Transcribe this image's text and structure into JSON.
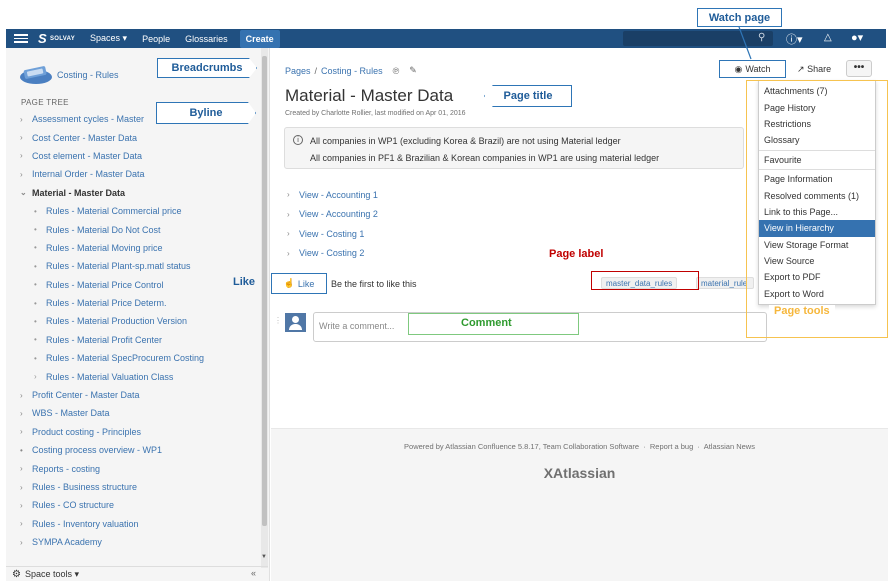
{
  "nav": {
    "logo": "SOLVAY",
    "items": [
      "Spaces ▾",
      "People",
      "Glossaries"
    ],
    "create": "Create"
  },
  "sidebar": {
    "space_title": "Costing - Rules",
    "tree_heading": "PAGE TREE",
    "tree": [
      {
        "label": "Assessment cycles - Master",
        "chev": "›"
      },
      {
        "label": "Cost Center - Master Data",
        "chev": "›"
      },
      {
        "label": "Cost element - Master Data",
        "chev": "›"
      },
      {
        "label": "Internal Order - Master Data",
        "chev": "›"
      },
      {
        "label": "Material - Master Data",
        "chev": "⌄"
      },
      {
        "label": "Rules - Material Commercial price",
        "chev": "•"
      },
      {
        "label": "Rules - Material Do Not Cost",
        "chev": "•"
      },
      {
        "label": "Rules - Material Moving price",
        "chev": "•"
      },
      {
        "label": "Rules - Material Plant-sp.matl status",
        "chev": "•"
      },
      {
        "label": "Rules - Material Price Control",
        "chev": "•"
      },
      {
        "label": "Rules - Material Price Determ.",
        "chev": "•"
      },
      {
        "label": "Rules - Material Production Version",
        "chev": "•"
      },
      {
        "label": "Rules - Material Profit Center",
        "chev": "•"
      },
      {
        "label": "Rules - Material SpecProcurem Costing",
        "chev": "•"
      },
      {
        "label": "Rules - Material Valuation Class",
        "chev": "›"
      },
      {
        "label": "Profit Center - Master Data",
        "chev": "›"
      },
      {
        "label": "WBS - Master Data",
        "chev": "›"
      },
      {
        "label": "Product costing - Principles",
        "chev": "›"
      },
      {
        "label": "Costing process overview - WP1",
        "chev": "•"
      },
      {
        "label": "Reports - costing",
        "chev": "›"
      },
      {
        "label": "Rules - Business structure",
        "chev": "›"
      },
      {
        "label": "Rules - CO structure",
        "chev": "›"
      },
      {
        "label": "Rules - Inventory valuation",
        "chev": "›"
      },
      {
        "label": "SYMPA Academy",
        "chev": "›"
      }
    ],
    "space_tools": "Space tools ▾",
    "collapse": "«"
  },
  "callouts": {
    "watch_page": "Watch page",
    "breadcrumbs": "Breadcrumbs",
    "page_title": "Page title",
    "byline": "Byline",
    "like": "Like",
    "page_label": "Page label",
    "comment": "Comment",
    "page_tools": "Page tools"
  },
  "page": {
    "breadcrumbs": [
      "Pages",
      "Costing - Rules"
    ],
    "title": "Material - Master Data",
    "byline": "Created by Charlotte Rollier, last modified on Apr 01, 2016",
    "info_line1": "All companies in WP1 (excluding Korea & Brazil) are not using Material ledger",
    "info_line2": "All companies in PF1 & Brazilian & Korean companies in WP1 are using material ledger",
    "children": [
      "View - Accounting 1",
      "View - Accounting 2",
      "View - Costing 1",
      "View - Costing 2"
    ],
    "like_label": "Like",
    "like_text": "Be the first to like this",
    "labels": [
      "master_data_rules",
      "material_rule"
    ],
    "comment_placeholder": "Write a comment..."
  },
  "toolbar": {
    "watch": "Watch",
    "share": "Share",
    "more": "•••"
  },
  "tools_menu": [
    "Attachments (7)",
    "Page History",
    "Restrictions",
    "Glossary",
    "---",
    "Favourite",
    "---",
    "Page Information",
    "Resolved comments (1)",
    "Link to this Page...",
    "View in Hierarchy",
    "View Storage Format",
    "View Source",
    "Export to PDF",
    "Export to Word"
  ],
  "tools_menu_active": "View in Hierarchy",
  "footer": {
    "powered": "Powered by Atlassian Confluence 5.8.17, Team Collaboration Software",
    "report_bug": "Report a bug",
    "news": "Atlassian News",
    "logo": "Atlassian"
  },
  "colors": {
    "nav_bg": "#205081",
    "link": "#3b73af",
    "callout_blue": "#2e75b6",
    "label_red": "#c00000",
    "comment_green": "#7fc97f",
    "tools_orange": "#f6c350"
  }
}
